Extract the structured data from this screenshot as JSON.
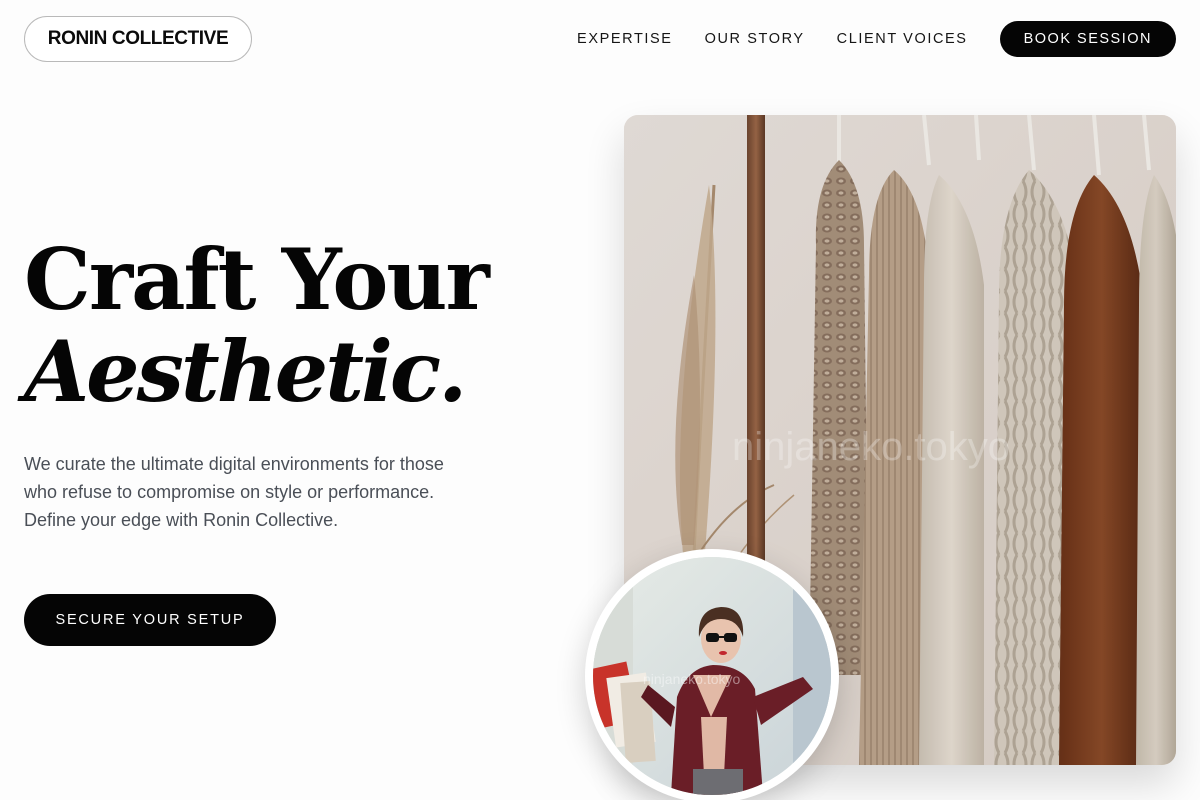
{
  "header": {
    "brand": "RONIN COLLECTIVE",
    "nav": [
      {
        "label": "EXPERTISE"
      },
      {
        "label": "OUR STORY"
      },
      {
        "label": "CLIENT VOICES"
      }
    ],
    "cta_label": "BOOK SESSION"
  },
  "hero": {
    "title_line1": "Craft Your",
    "title_line2": "Aesthetic.",
    "description": "We curate the ultimate digital environments for those who refuse to compromise on style or performance. Define your edge with Ronin Collective.",
    "cta_label": "SECURE YOUR SETUP"
  },
  "images": {
    "main_alt": "Neutral-toned knitwear and jackets hanging on a wooden rail beside dried pampas grass",
    "main_watermark": "ninjaneko.tokyo",
    "circle_alt": "Woman in sunglasses and a burgundy coat holding shopping bags",
    "circle_watermark": "ninjaneko.tokyo"
  },
  "colors": {
    "background": "#fdfdfd",
    "ink": "#050505",
    "muted_text": "#4a4f57",
    "button_bg": "#050505",
    "button_text": "#ffffff"
  }
}
